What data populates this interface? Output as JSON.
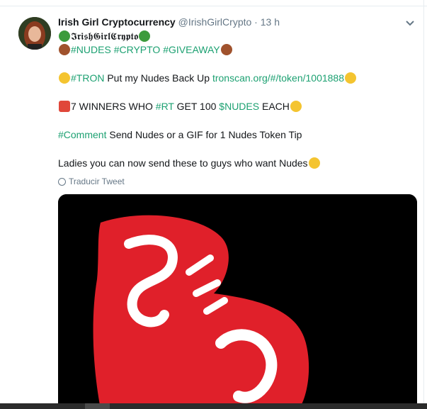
{
  "tweet": {
    "display_name": "Irish Girl Cryptocurrency",
    "handle": "@IrishGirlCrypto",
    "separator": "·",
    "time": "13 h",
    "bio_name": "𝕴𝖗𝖎𝖘𝖍𝕲𝖎𝖗𝖑𝕮𝖗𝖞𝖕𝖙𝖔",
    "hashtags_line": [
      "#NUDES",
      "#CRYPTO",
      "#GIVEAWAY"
    ],
    "line2": {
      "tag": "#TRON",
      "text": " Put my Nudes Back Up ",
      "link": "tronscan.org/#/token/1001888"
    },
    "line3": {
      "pre": "7 WINNERS WHO ",
      "tag": "#RT",
      "mid": " GET 100 ",
      "cash": "$NUDES",
      "post": " EACH"
    },
    "line4": {
      "tag": "#Comment",
      "text": " Send Nudes or a GIF for 1 Nudes Token Tip"
    },
    "line5": "Ladies you can now send these to guys who want Nudes",
    "translate_label": "Traducir Tweet"
  },
  "colors": {
    "accent": "#1da172",
    "secondary": "#657786",
    "image_red": "#e0202a"
  },
  "icons": [
    "chevron-down-icon",
    "clover-icon",
    "monkey-emoji-icon",
    "laughing-emoji-icon",
    "heart-eyes-emoji-icon",
    "gift-emoji-icon",
    "smile-emoji-icon",
    "rofl-emoji-icon",
    "globe-icon"
  ]
}
